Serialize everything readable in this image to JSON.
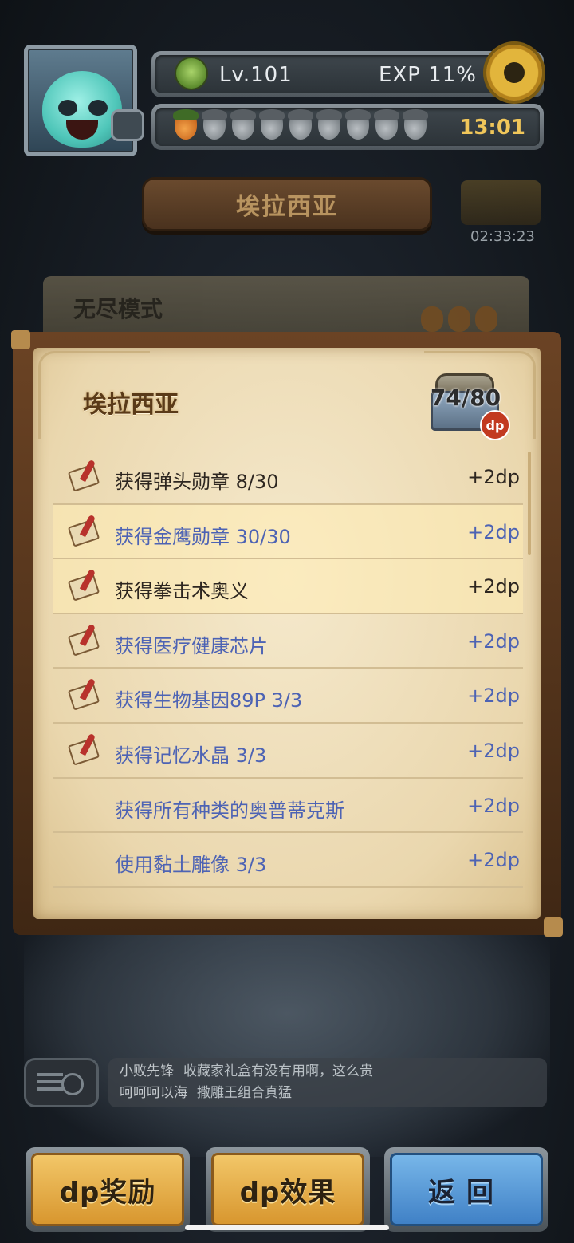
{
  "hud": {
    "level": "Lv.101",
    "exp": "EXP 11%",
    "timer": "13:01",
    "stamina_filled": 1,
    "stamina_total": 9
  },
  "region": {
    "sign": "埃拉西亚",
    "gift_timer": "02:33:23"
  },
  "back_card": {
    "title": "无尽模式"
  },
  "panel": {
    "title": "埃拉西亚",
    "chest_count": "74/80",
    "chest_badge": "dp",
    "items": [
      {
        "label": "获得弹头勋章 8/30",
        "reward": "+2dp",
        "done": false,
        "highlight": false,
        "icon": "scroll-quill-icon"
      },
      {
        "label": "获得金鹰勋章 30/30",
        "reward": "+2dp",
        "done": true,
        "highlight": true,
        "icon": "scroll-quill-icon"
      },
      {
        "label": "获得拳击术奥义",
        "reward": "+2dp",
        "done": false,
        "highlight": true,
        "icon": "scroll-quill-icon"
      },
      {
        "label": "获得医疗健康芯片",
        "reward": "+2dp",
        "done": true,
        "highlight": false,
        "icon": "scroll-quill-icon"
      },
      {
        "label": "获得生物基因89P 3/3",
        "reward": "+2dp",
        "done": true,
        "highlight": false,
        "icon": "scroll-quill-icon"
      },
      {
        "label": "获得记忆水晶 3/3",
        "reward": "+2dp",
        "done": true,
        "highlight": false,
        "icon": "scroll-quill-icon"
      },
      {
        "label": "获得所有种类的奥普蒂克斯",
        "reward": "+2dp",
        "done": true,
        "highlight": false,
        "icon": ""
      },
      {
        "label": "使用黏土雕像 3/3",
        "reward": "+2dp",
        "done": true,
        "highlight": false,
        "icon": ""
      }
    ]
  },
  "chat": {
    "lines": [
      {
        "name": "小败先锋",
        "text": "收藏家礼盒有没有用啊，这么贵"
      },
      {
        "name": "呵呵呵以海",
        "text": "撒雕王组合真猛"
      }
    ]
  },
  "buttons": {
    "dp_reward": "dp奖励",
    "dp_effect": "dp效果",
    "back": "返回"
  },
  "colors": {
    "done_text": "#4d63b4",
    "pending_text": "#2d2620",
    "yellow_button": "#e6ac45",
    "blue_button": "#5c9cd8"
  }
}
